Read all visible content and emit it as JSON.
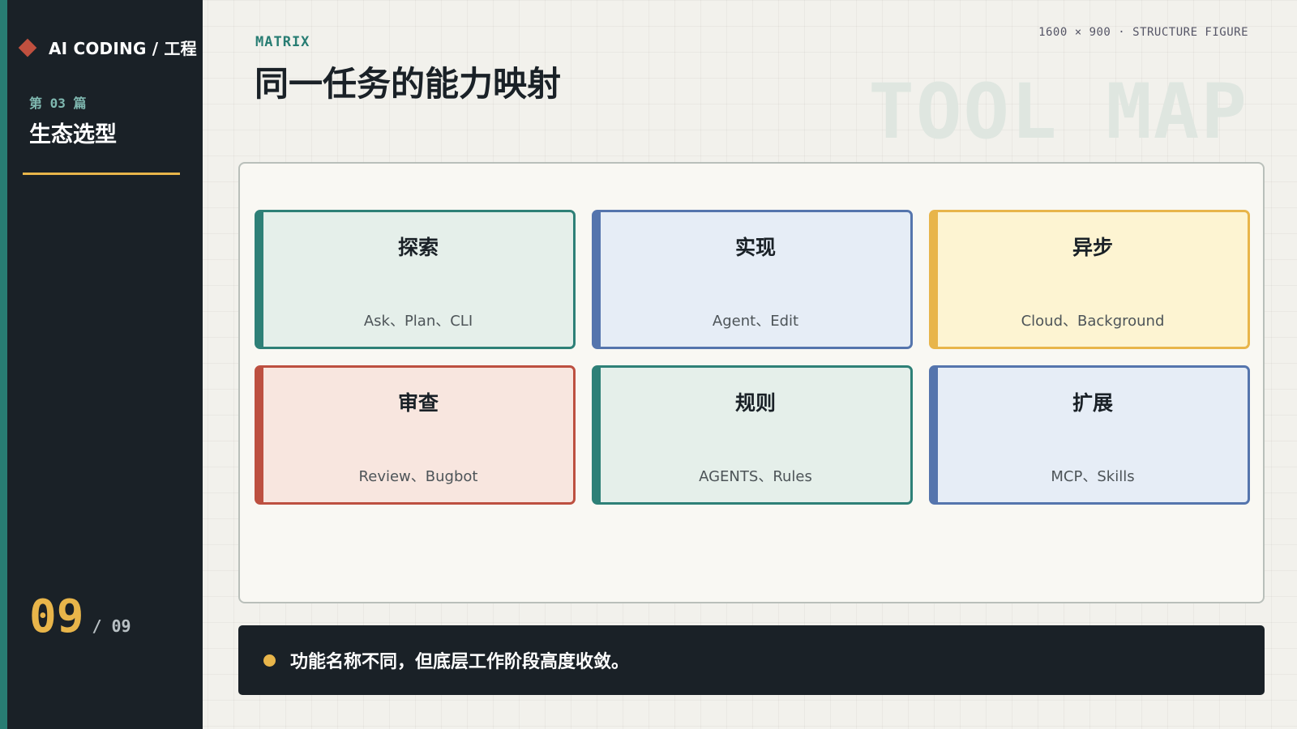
{
  "sidebar": {
    "brand": "AI CODING / 工程",
    "chapter": "第 03 篇",
    "section_title": "生态选型",
    "page_current": "09",
    "page_total": "/ 09"
  },
  "header": {
    "eyebrow": "MATRIX",
    "title": "同一任务的能力映射",
    "meta": "1600 × 900 · STRUCTURE FIGURE",
    "watermark": "TOOL MAP"
  },
  "matrix": {
    "cards": [
      {
        "title": "探索",
        "sub": "Ask、Plan、CLI",
        "color": "#2e8077"
      },
      {
        "title": "实现",
        "sub": "Agent、Edit",
        "color": "#5575ad"
      },
      {
        "title": "异步",
        "sub": "Cloud、Background",
        "color": "#e8b54a"
      },
      {
        "title": "审查",
        "sub": "Review、Bugbot",
        "color": "#bd5040"
      },
      {
        "title": "规则",
        "sub": "AGENTS、Rules",
        "color": "#2e8077"
      },
      {
        "title": "扩展",
        "sub": "MCP、Skills",
        "color": "#5575ad"
      }
    ]
  },
  "note": {
    "text": "功能名称不同，但底层工作阶段高度收敛。"
  },
  "colors": {
    "sidebar_bg": "#1a2127",
    "accent_teal": "#287d73",
    "accent_yellow": "#e8b54a",
    "accent_red": "#c0503f"
  }
}
